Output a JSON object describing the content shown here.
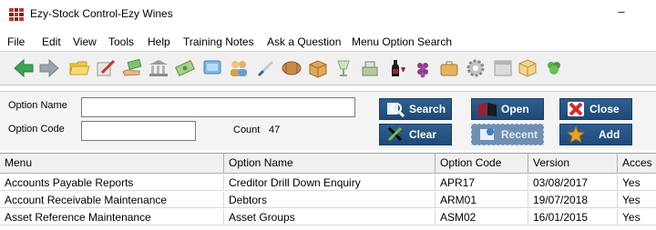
{
  "window": {
    "title": "Ezy-Stock Control-Ezy Wines",
    "minimize_glyph": "–"
  },
  "menu": {
    "items": [
      "File",
      "Edit",
      "View",
      "Tools",
      "Help",
      "Training Notes",
      "Ask a Question",
      "Menu Option Search"
    ]
  },
  "toolbar": {
    "icons": [
      "back-arrow-icon",
      "forward-arrow-icon",
      "folder-open-icon",
      "pen-notepad-icon",
      "hand-payment-icon",
      "bank-icon",
      "cash-icon",
      "screen-icon",
      "people-icon",
      "wand-icon",
      "barrel-icon",
      "crate-icon",
      "glass-icon",
      "till-icon",
      "wine-bottle-icon",
      "grapes-icon",
      "briefcase-icon",
      "gear-icon",
      "window-icon",
      "cube-icon",
      "plant-icon"
    ]
  },
  "form": {
    "option_name_label": "Option Name",
    "option_code_label": "Option Code",
    "option_name_value": "",
    "option_code_value": "",
    "count_label": "Count",
    "count_value": "47"
  },
  "buttons": {
    "search": "Search",
    "clear": "Clear",
    "open": "Open",
    "recent": "Recent",
    "close": "Close",
    "add": "Add"
  },
  "colors": {
    "button_bg": "#1e4a78",
    "recent_bg": "#6e8fb3",
    "close_icon": "#d62b2b",
    "add_icon": "#f0a020"
  },
  "table": {
    "columns": [
      "Menu",
      "Option Name",
      "Option Code",
      "Version",
      "Acces"
    ],
    "rows": [
      [
        "Accounts Payable Reports",
        "Creditor Drill Down Enquiry",
        "APR17",
        "03/08/2017",
        "Yes"
      ],
      [
        "Account Receivable Maintenance",
        "Debtors",
        "ARM01",
        "19/07/2018",
        "Yes"
      ],
      [
        "Asset Reference Maintenance",
        "Asset Groups",
        "ASM02",
        "16/01/2015",
        "Yes"
      ]
    ]
  }
}
